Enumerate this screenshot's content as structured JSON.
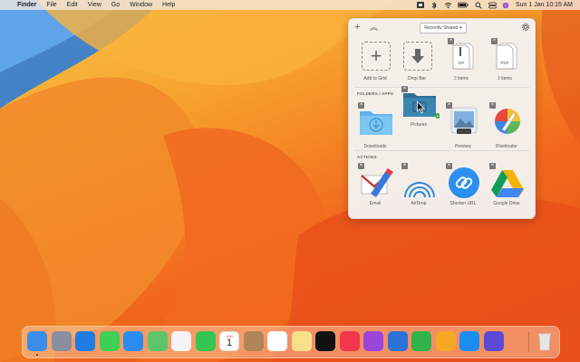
{
  "menubar": {
    "apple": "",
    "app_name": "Finder",
    "menus": [
      "File",
      "Edit",
      "View",
      "Go",
      "Window",
      "Help"
    ],
    "datetime": "Sun 1 Jan  10:15 AM",
    "status_icons": [
      "dropzone-icon",
      "bluetooth-icon",
      "wifi-icon",
      "battery-icon",
      "search-icon",
      "control-center-icon",
      "siri-icon"
    ]
  },
  "panel": {
    "top": {
      "add_label": "+",
      "collapse_label": "︽",
      "dropdown_value": "Recently Shared",
      "dropdown_arrow": "▾",
      "settings_icon": "gear-icon"
    },
    "top_tiles": [
      {
        "label": "Add to Grid",
        "icon": "plus-icon"
      },
      {
        "label": "Drop Bar",
        "icon": "download-arrow-icon"
      },
      {
        "label": "2 items",
        "icon": "zip-file-icon",
        "badge": "ZIP"
      },
      {
        "label": "2 items",
        "icon": "pdf-file-icon",
        "badge": "PDF"
      }
    ],
    "folders_title": "FOLDERS / APPS",
    "folders": [
      {
        "label": "Downloads",
        "icon": "downloads-folder-icon"
      },
      {
        "label": "Pictures",
        "icon": "pictures-folder-icon"
      },
      {
        "label": "Preview",
        "icon": "preview-app-icon"
      },
      {
        "label": "Pixelmator",
        "icon": "pixelmator-app-icon"
      }
    ],
    "actions_title": "ACTIONS",
    "actions": [
      {
        "label": "Email",
        "icon": "email-action-icon"
      },
      {
        "label": "AirDrop",
        "icon": "airdrop-icon"
      },
      {
        "label": "Shorten URL",
        "icon": "shorten-url-icon"
      },
      {
        "label": "Google Drive",
        "icon": "google-drive-icon"
      }
    ],
    "remove_glyph": "×"
  },
  "calendar": {
    "month": "JAN",
    "day": "1"
  },
  "dock": {
    "apps": [
      {
        "name": "finder-icon",
        "color": "#3b8de8"
      },
      {
        "name": "launchpad-icon",
        "color": "#8a8fa0"
      },
      {
        "name": "safari-icon",
        "color": "#1f7ce0"
      },
      {
        "name": "messages-icon",
        "color": "#3fcf54"
      },
      {
        "name": "mail-icon",
        "color": "#2a8cf0"
      },
      {
        "name": "maps-icon",
        "color": "#5cc56a"
      },
      {
        "name": "photos-icon",
        "color": "#f4f4f4"
      },
      {
        "name": "facetime-icon",
        "color": "#36c451"
      },
      {
        "name": "calendar-icon",
        "color": "#ffffff"
      },
      {
        "name": "contacts-icon",
        "color": "#b08557"
      },
      {
        "name": "reminders-icon",
        "color": "#ffffff"
      },
      {
        "name": "notes-icon",
        "color": "#f8e08a"
      },
      {
        "name": "tv-icon",
        "color": "#111111"
      },
      {
        "name": "music-icon",
        "color": "#f2374c"
      },
      {
        "name": "podcasts-icon",
        "color": "#9b46d9"
      },
      {
        "name": "keynote-icon",
        "color": "#2b73d9"
      },
      {
        "name": "numbers-icon",
        "color": "#2fb34a"
      },
      {
        "name": "pages-icon",
        "color": "#f5a623"
      },
      {
        "name": "app-store-icon",
        "color": "#1b8cf2"
      },
      {
        "name": "shortcuts-icon",
        "color": "#5b4ad8"
      },
      {
        "name": "trash-icon",
        "color": "#e8e8e8"
      }
    ]
  }
}
